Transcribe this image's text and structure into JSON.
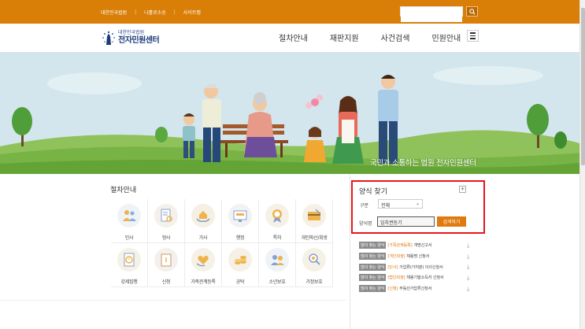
{
  "topbar": {
    "links": [
      "대한민국법원",
      "나홀로소송",
      "사이트맵"
    ],
    "search_placeholder": "",
    "search_icon": "search-icon",
    "color": "#d97f08"
  },
  "header": {
    "logo_small": "대한민국법원",
    "logo_big": "전자민원센터",
    "nav": [
      "절차안내",
      "재판지원",
      "사건검색",
      "민원안내"
    ],
    "menu_icon": "hamburger-icon"
  },
  "hero": {
    "tagline": "국민과 소통하는 법원 전자민원센터"
  },
  "procedure": {
    "title": "절차안내",
    "items": [
      {
        "label": "민사",
        "icon": "people-icon"
      },
      {
        "label": "형사",
        "icon": "document-search-icon"
      },
      {
        "label": "가사",
        "icon": "house-hands-icon"
      },
      {
        "label": "행정",
        "icon": "monitor-icon"
      },
      {
        "label": "특허",
        "icon": "medal-icon"
      },
      {
        "label": "개인파산/회생",
        "icon": "card-icon"
      },
      {
        "label": "강제집행",
        "icon": "document-clock-icon"
      },
      {
        "label": "신청",
        "icon": "folder-icon"
      },
      {
        "label": "가족관계등록",
        "icon": "heart-hand-icon"
      },
      {
        "label": "공탁",
        "icon": "coins-icon"
      },
      {
        "label": "소년보호",
        "icon": "children-icon"
      },
      {
        "label": "가정보호",
        "icon": "magnifier-icon"
      }
    ]
  },
  "form_search": {
    "title": "양식 찾기",
    "category_label": "구분",
    "category_value": "전체",
    "name_label": "양식명",
    "name_value": "임차권등기",
    "button": "검색하기",
    "highlight_color": "#e5171c"
  },
  "form_list": [
    {
      "badge": "많이 찾는 양식",
      "category": "[가족관계등록]",
      "name": "개명신고서"
    },
    {
      "badge": "많이 찾는 양식",
      "category": "[개인회생]",
      "name": "채용명 신청서"
    },
    {
      "badge": "많이 찾는 양식",
      "category": "[민사]",
      "name": "가압류(가처분) 이의신청서"
    },
    {
      "badge": "많이 찾는 양식",
      "category": "[법인회생]",
      "name": "채용기말소득자 신청서"
    },
    {
      "badge": "많이 찾는 양식",
      "category": "[신청]",
      "name": "부동산가압류신청서"
    }
  ]
}
